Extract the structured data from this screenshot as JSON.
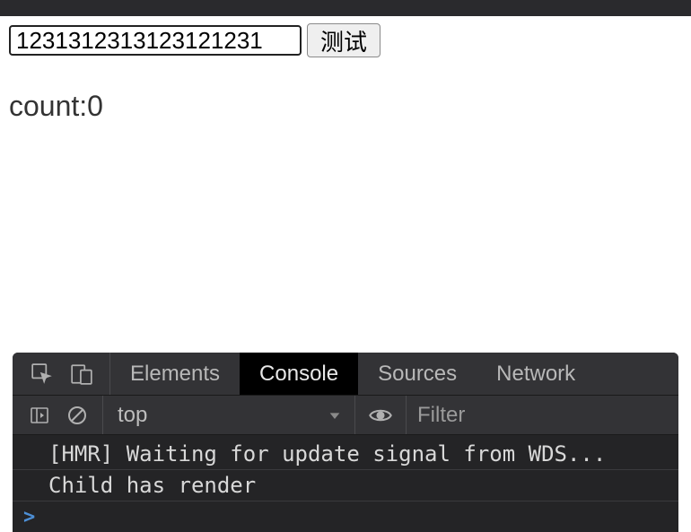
{
  "page": {
    "input_value": "1231312313123121231",
    "test_button_label": "测试",
    "count_label": "count:",
    "count_value": "0"
  },
  "devtools": {
    "tabs": {
      "elements": "Elements",
      "console": "Console",
      "sources": "Sources",
      "network": "Network"
    },
    "toolbar": {
      "context": "top",
      "filter_placeholder": "Filter"
    },
    "console_lines": [
      "[HMR] Waiting for update signal from WDS...",
      "Child has render"
    ],
    "prompt": ">"
  }
}
